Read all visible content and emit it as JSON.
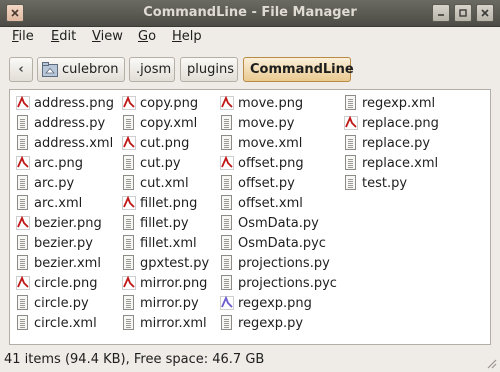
{
  "window": {
    "title": "CommandLine - File Manager"
  },
  "menu": [
    {
      "accel": "F",
      "rest": "ile"
    },
    {
      "accel": "E",
      "rest": "dit"
    },
    {
      "accel": "V",
      "rest": "iew"
    },
    {
      "accel": "G",
      "rest": "o"
    },
    {
      "accel": "H",
      "rest": "elp"
    }
  ],
  "path": {
    "back_glyph": "‹",
    "segments": [
      "culebron",
      ".josm",
      "plugins",
      "CommandLine"
    ]
  },
  "files": [
    {
      "name": "address.png",
      "icon": "image-icon",
      "color": "#c01818"
    },
    {
      "name": "address.py",
      "icon": "text-file-icon"
    },
    {
      "name": "address.xml",
      "icon": "text-file-icon"
    },
    {
      "name": "arc.png",
      "icon": "image-icon",
      "color": "#c01818"
    },
    {
      "name": "arc.py",
      "icon": "text-file-icon"
    },
    {
      "name": "arc.xml",
      "icon": "text-file-icon"
    },
    {
      "name": "bezier.png",
      "icon": "image-icon",
      "color": "#c01818"
    },
    {
      "name": "bezier.py",
      "icon": "text-file-icon"
    },
    {
      "name": "bezier.xml",
      "icon": "text-file-icon"
    },
    {
      "name": "circle.png",
      "icon": "image-icon",
      "color": "#c01818"
    },
    {
      "name": "circle.py",
      "icon": "text-file-icon"
    },
    {
      "name": "circle.xml",
      "icon": "text-file-icon"
    },
    {
      "name": "copy.png",
      "icon": "image-icon",
      "color": "#c01818"
    },
    {
      "name": "copy.xml",
      "icon": "text-file-icon"
    },
    {
      "name": "cut.png",
      "icon": "image-icon",
      "color": "#c01818"
    },
    {
      "name": "cut.py",
      "icon": "text-file-icon"
    },
    {
      "name": "cut.xml",
      "icon": "text-file-icon"
    },
    {
      "name": "fillet.png",
      "icon": "image-icon",
      "color": "#c01818"
    },
    {
      "name": "fillet.py",
      "icon": "text-file-icon"
    },
    {
      "name": "fillet.xml",
      "icon": "text-file-icon"
    },
    {
      "name": "gpxtest.py",
      "icon": "text-file-icon"
    },
    {
      "name": "mirror.png",
      "icon": "image-icon",
      "color": "#c01818"
    },
    {
      "name": "mirror.py",
      "icon": "text-file-icon"
    },
    {
      "name": "mirror.xml",
      "icon": "text-file-icon"
    },
    {
      "name": "move.png",
      "icon": "image-icon",
      "color": "#c01818"
    },
    {
      "name": "move.py",
      "icon": "text-file-icon"
    },
    {
      "name": "move.xml",
      "icon": "text-file-icon"
    },
    {
      "name": "offset.png",
      "icon": "image-icon",
      "color": "#c01818"
    },
    {
      "name": "offset.py",
      "icon": "text-file-icon"
    },
    {
      "name": "offset.xml",
      "icon": "text-file-icon"
    },
    {
      "name": "OsmData.py",
      "icon": "text-file-icon"
    },
    {
      "name": "OsmData.pyc",
      "icon": "text-file-icon"
    },
    {
      "name": "projections.py",
      "icon": "text-file-icon"
    },
    {
      "name": "projections.pyc",
      "icon": "text-file-icon"
    },
    {
      "name": "regexp.png",
      "icon": "image-icon",
      "color": "#6a5acd"
    },
    {
      "name": "regexp.py",
      "icon": "text-file-icon"
    },
    {
      "name": "regexp.xml",
      "icon": "text-file-icon"
    },
    {
      "name": "replace.png",
      "icon": "image-icon",
      "color": "#c01818"
    },
    {
      "name": "replace.py",
      "icon": "text-file-icon"
    },
    {
      "name": "replace.xml",
      "icon": "text-file-icon"
    },
    {
      "name": "test.py",
      "icon": "text-file-icon"
    }
  ],
  "status": {
    "text": "41 items (94.4 KB), Free space: 46.7 GB"
  }
}
